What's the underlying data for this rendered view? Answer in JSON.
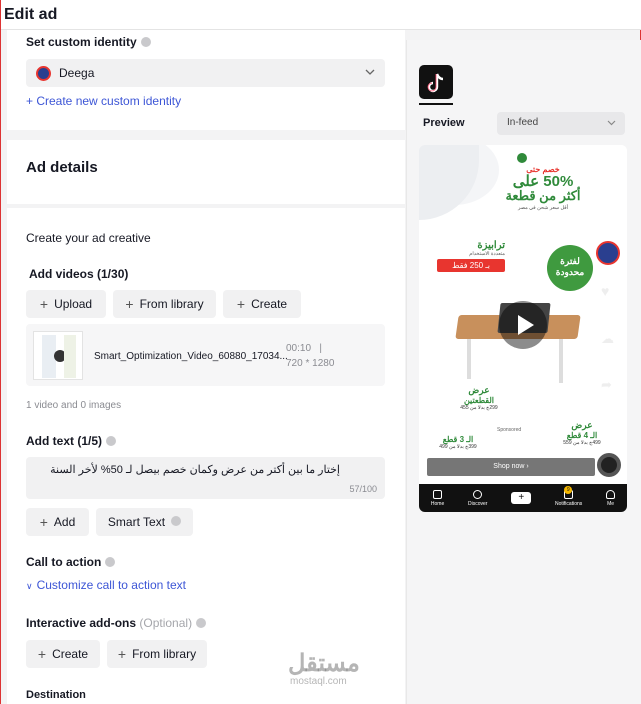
{
  "page": {
    "title": "Edit ad"
  },
  "identity": {
    "label": "Set custom identity",
    "selected": "Deega",
    "create_link": "+ Create new custom identity"
  },
  "ad_details": {
    "heading": "Ad details",
    "creative_heading": "Create your ad creative",
    "videos_label": "Add videos (1/30)",
    "upload": "Upload",
    "from_library": "From library",
    "create": "Create",
    "video": {
      "filename": "Smart_Optimization_Video_60880_17034...",
      "duration": "00:10",
      "separator": "|",
      "resolution": "720 * 1280"
    },
    "video_count": "1 video and 0 images",
    "text_label": "Add text (1/5)",
    "ad_text": "إختار ما بين أكتر من عرض وكمان خصم بيصل لـ 50% لأخر السنة",
    "text_counter": "57/100",
    "add": "Add",
    "smart_text": "Smart Text",
    "cta_label": "Call to action",
    "cta_link": "Customize call to action text",
    "addons_label": "Interactive add-ons",
    "addons_optional": "(Optional)",
    "addons_create": "Create",
    "addons_library": "From library",
    "destination": "Destination"
  },
  "preview": {
    "label": "Preview",
    "placement": "In-feed",
    "ad": {
      "headline_small": "خصم حتى",
      "headline_big": "50% على",
      "headline_more": "أكثر من قطعة",
      "sub": "أقل سعر شحن في مصر",
      "badge_left_1": "ترابيزة",
      "badge_left_2": "متعددة الاستخدام",
      "badge_left_price": "بـ 250 فقط",
      "badge_right_1": "لفترة",
      "badge_right_2": "محدودة",
      "offer_mid": "عرض",
      "offer_mid_2": "القطعتين",
      "price_mid": "299ج بدلا من 455",
      "sponsored": "Sponsored",
      "offer_left": "الـ 3 قطع",
      "offer_left_price": "399ج بدلا من 499",
      "offer_right": "عرض",
      "offer_right_2": "الـ 4 قطع",
      "offer_right_price": "499ج بدلا من 559",
      "shop_now": "Shop now  ›"
    },
    "tabs": [
      "Home",
      "Discover",
      "",
      "Notifications",
      "Me"
    ],
    "notif_badge": "9"
  },
  "watermark": {
    "main": "مستقل",
    "sub": "mostaql.com"
  },
  "colors": {
    "link": "#3d56d6",
    "brand_green": "#2f8a3a",
    "brand_red": "#e8352f"
  }
}
